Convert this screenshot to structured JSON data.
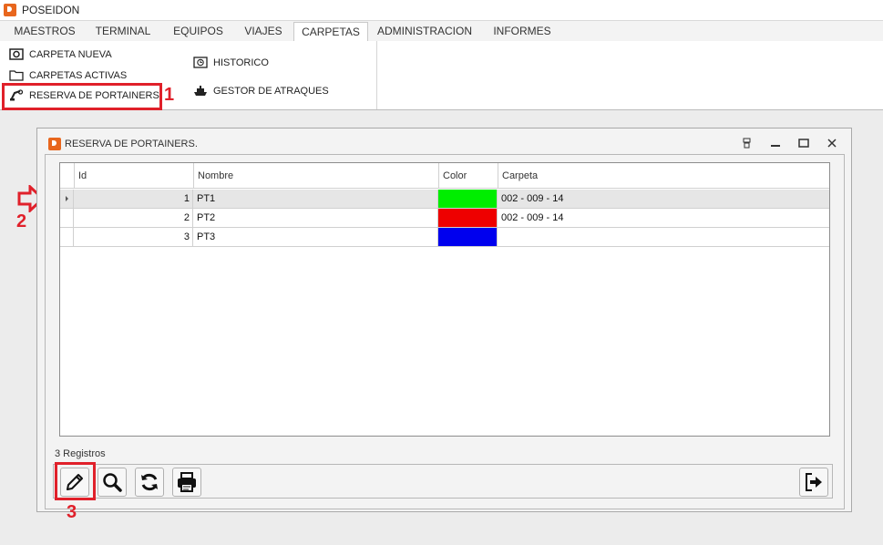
{
  "app": {
    "title": "POSEIDON"
  },
  "menu": {
    "tabs": [
      "MAESTROS",
      "TERMINAL",
      "EQUIPOS",
      "VIAJES",
      "CARPETAS",
      "ADMINISTRACION",
      "INFORMES"
    ],
    "active": "CARPETAS"
  },
  "ribbon": {
    "carpeta_nueva": "CARPETA NUEVA",
    "carpetas_activas": "CARPETAS ACTIVAS",
    "reserva_portainers": "RESERVA DE PORTAINERS.",
    "historico": "HISTORICO",
    "gestor_atraques": "GESTOR DE ATRAQUES"
  },
  "annotations": {
    "marker1": "1",
    "marker2": "2",
    "marker3": "3",
    "color": "#e0202a"
  },
  "dialog": {
    "title": "RESERVA DE PORTAINERS.",
    "grid": {
      "columns": [
        "Id",
        "Nombre",
        "Color",
        "Carpeta"
      ],
      "rows": [
        {
          "id": "1",
          "nombre": "PT1",
          "color": "#00ee00",
          "carpeta": "002 - 009 - 14"
        },
        {
          "id": "2",
          "nombre": "PT2",
          "color": "#ee0000",
          "carpeta": "002 - 009 - 14"
        },
        {
          "id": "3",
          "nombre": "PT3",
          "color": "#0000ee",
          "carpeta": ""
        }
      ]
    },
    "records": "3 Registros",
    "toolbar": {
      "edit": "pencil-icon",
      "search": "magnifier-icon",
      "refresh": "refresh-icon",
      "print": "printer-icon",
      "exit": "exit-icon"
    }
  }
}
